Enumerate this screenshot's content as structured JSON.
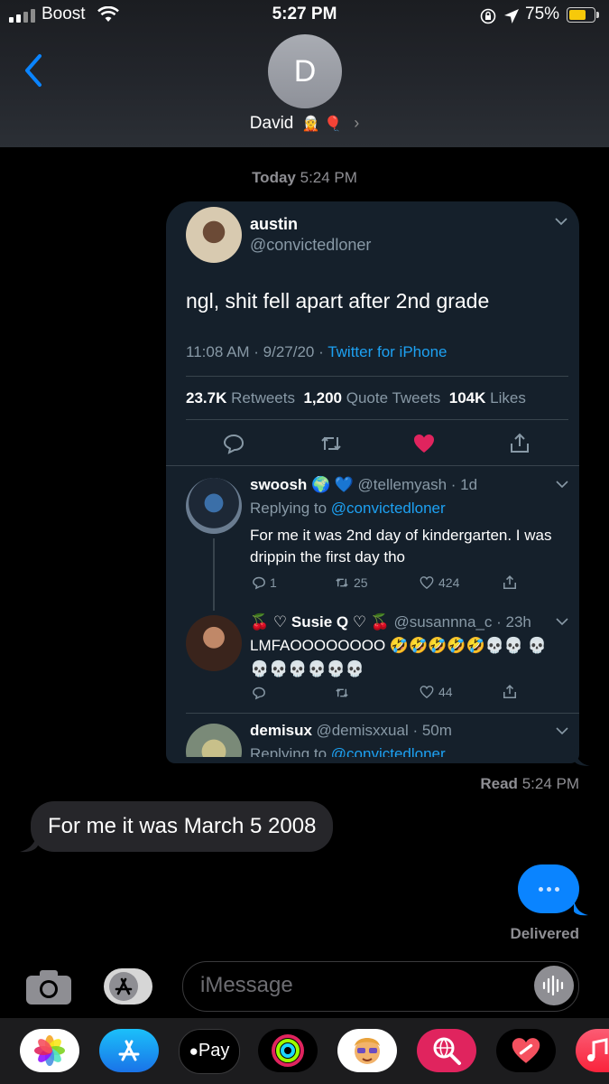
{
  "status": {
    "carrier": "Boost",
    "time": "5:27 PM",
    "battery_percent": "75%",
    "battery_level": 0.75,
    "battery_color": "#f7c90a"
  },
  "header": {
    "avatar_initial": "D",
    "contact_name": "David",
    "contact_emoji": "🧝 🎈"
  },
  "conversation": {
    "timestamp_day": "Today",
    "timestamp_time": "5:24 PM",
    "read_label": "Read",
    "read_time": "5:24 PM",
    "incoming_message": "For me it was March 5 2008",
    "delivered_label": "Delivered"
  },
  "tweet": {
    "name": "austin",
    "handle": "@convictedloner",
    "text": "ngl, shit fell apart after 2nd grade",
    "time": "11:08 AM · 9/27/20 ·",
    "source": "Twitter for iPhone",
    "retweets_count": "23.7K",
    "retweets_label": "Retweets",
    "quotes_count": "1,200",
    "quotes_label": "Quote Tweets",
    "likes_count": "104K",
    "likes_label": "Likes",
    "like_color": "#e0245e"
  },
  "replies": [
    {
      "name": "swoosh 🌍 💙",
      "handle": "@tellemyash · 1d",
      "replying_prefix": "Replying to",
      "replying_handle": "@convictedloner",
      "text": "For me it was 2nd day of kindergarten. I was drippin the first day tho",
      "reply_count": "1",
      "retweet_count": "25",
      "like_count": "424"
    },
    {
      "name": "🍒 ♡ Susie Q ♡ 🍒",
      "handle": "@susannna_c · 23h",
      "text": "LMFAOOOOOOOO 🤣🤣🤣🤣🤣💀💀 💀💀💀💀💀💀💀",
      "reply_count": "",
      "retweet_count": "",
      "like_count": "44"
    },
    {
      "name": "demisux",
      "handle": "@demisxxual · 50m",
      "replying_prefix": "Replying to",
      "replying_handle": "@convictedloner"
    }
  ],
  "input": {
    "placeholder": "iMessage"
  },
  "drawer": {
    "apple_pay_label": "Pay",
    "apps": [
      "photos-app",
      "app-store-app",
      "apple-pay-app",
      "activity-app",
      "memoji-app",
      "web-search-app",
      "heart-app",
      "music-app"
    ]
  },
  "colors": {
    "accent_blue": "#0a84ff",
    "twitter_blue": "#1da1f2",
    "card_bg": "#15202b",
    "incoming_bubble": "#26262a"
  }
}
